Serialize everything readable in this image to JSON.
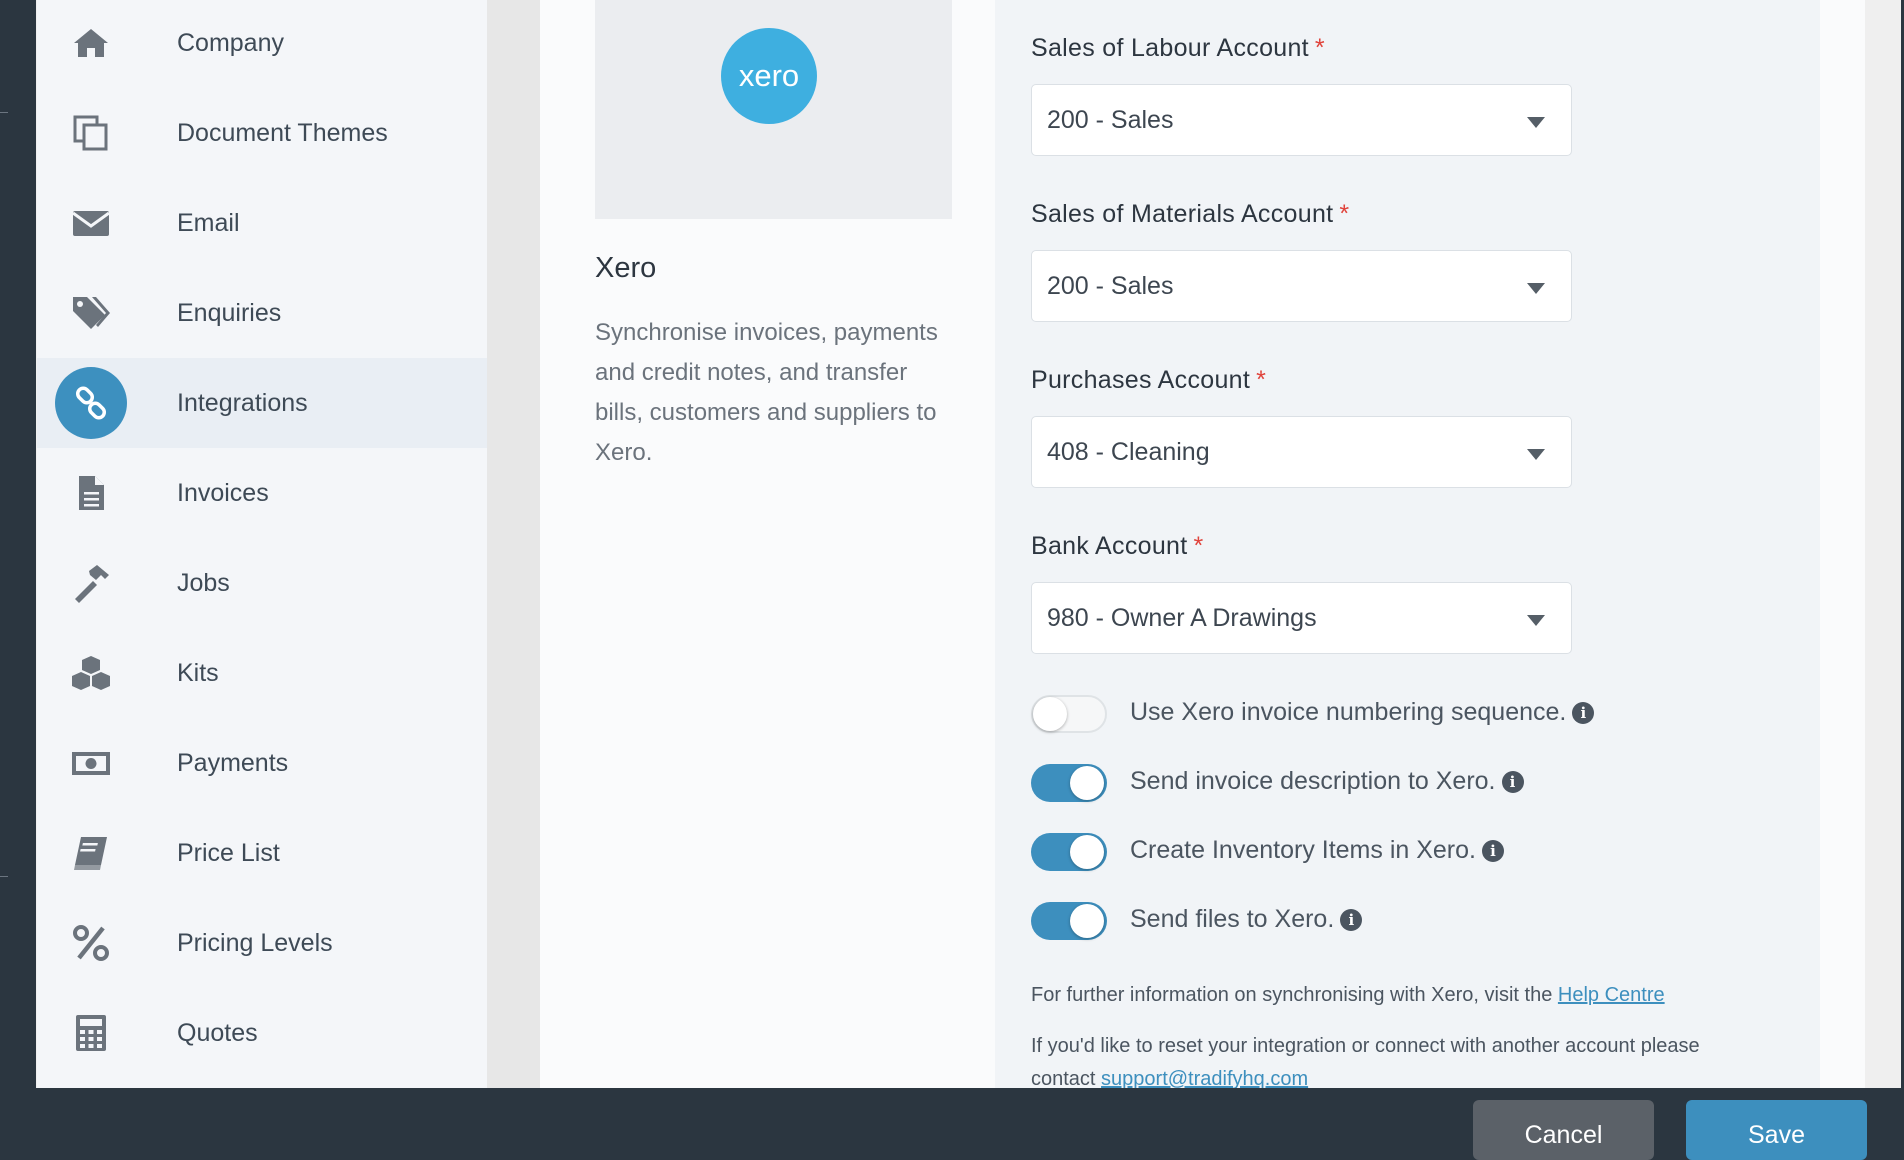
{
  "sidebar": {
    "items": [
      {
        "label": "Company",
        "icon": "home-icon"
      },
      {
        "label": "Document Themes",
        "icon": "copy-icon"
      },
      {
        "label": "Email",
        "icon": "envelope-icon"
      },
      {
        "label": "Enquiries",
        "icon": "tags-icon"
      },
      {
        "label": "Integrations",
        "icon": "link-icon",
        "active": true
      },
      {
        "label": "Invoices",
        "icon": "document-icon"
      },
      {
        "label": "Jobs",
        "icon": "hammer-icon"
      },
      {
        "label": "Kits",
        "icon": "cubes-icon"
      },
      {
        "label": "Payments",
        "icon": "money-icon"
      },
      {
        "label": "Price List",
        "icon": "book-icon"
      },
      {
        "label": "Pricing Levels",
        "icon": "percent-icon"
      },
      {
        "label": "Quotes",
        "icon": "calculator-icon"
      }
    ]
  },
  "integration": {
    "logo_text": "xero",
    "title": "Xero",
    "description": "Synchronise invoices, payments and credit notes, and transfer bills, customers and suppliers to Xero."
  },
  "settings": {
    "fields": [
      {
        "label": "Sales of Labour Account",
        "required_mark": "*",
        "value": "200 - Sales"
      },
      {
        "label": "Sales of Materials Account",
        "required_mark": "*",
        "value": "200 - Sales"
      },
      {
        "label": "Purchases Account",
        "required_mark": "*",
        "value": "408 - Cleaning"
      },
      {
        "label": "Bank Account",
        "required_mark": "*",
        "value": "980 - Owner A Drawings"
      }
    ],
    "toggles": [
      {
        "label": "Use Xero invoice numbering sequence.",
        "on": false
      },
      {
        "label": "Send invoice description to Xero.",
        "on": true
      },
      {
        "label": "Create Inventory Items in Xero.",
        "on": true
      },
      {
        "label": "Send files to Xero.",
        "on": true
      }
    ],
    "help_text": "For further information on synchronising with Xero, visit the",
    "help_link": "Help Centre",
    "reset_text": "If you'd like to reset your integration or connect with another account please",
    "contact_prefix": "contact",
    "contact_email": "support@tradifyhq.com"
  },
  "footer": {
    "cancel_label": "Cancel",
    "save_label": "Save"
  },
  "colors": {
    "accent": "#3d8fbe",
    "required": "#e0433b",
    "xero_brand": "#3eafe0"
  }
}
